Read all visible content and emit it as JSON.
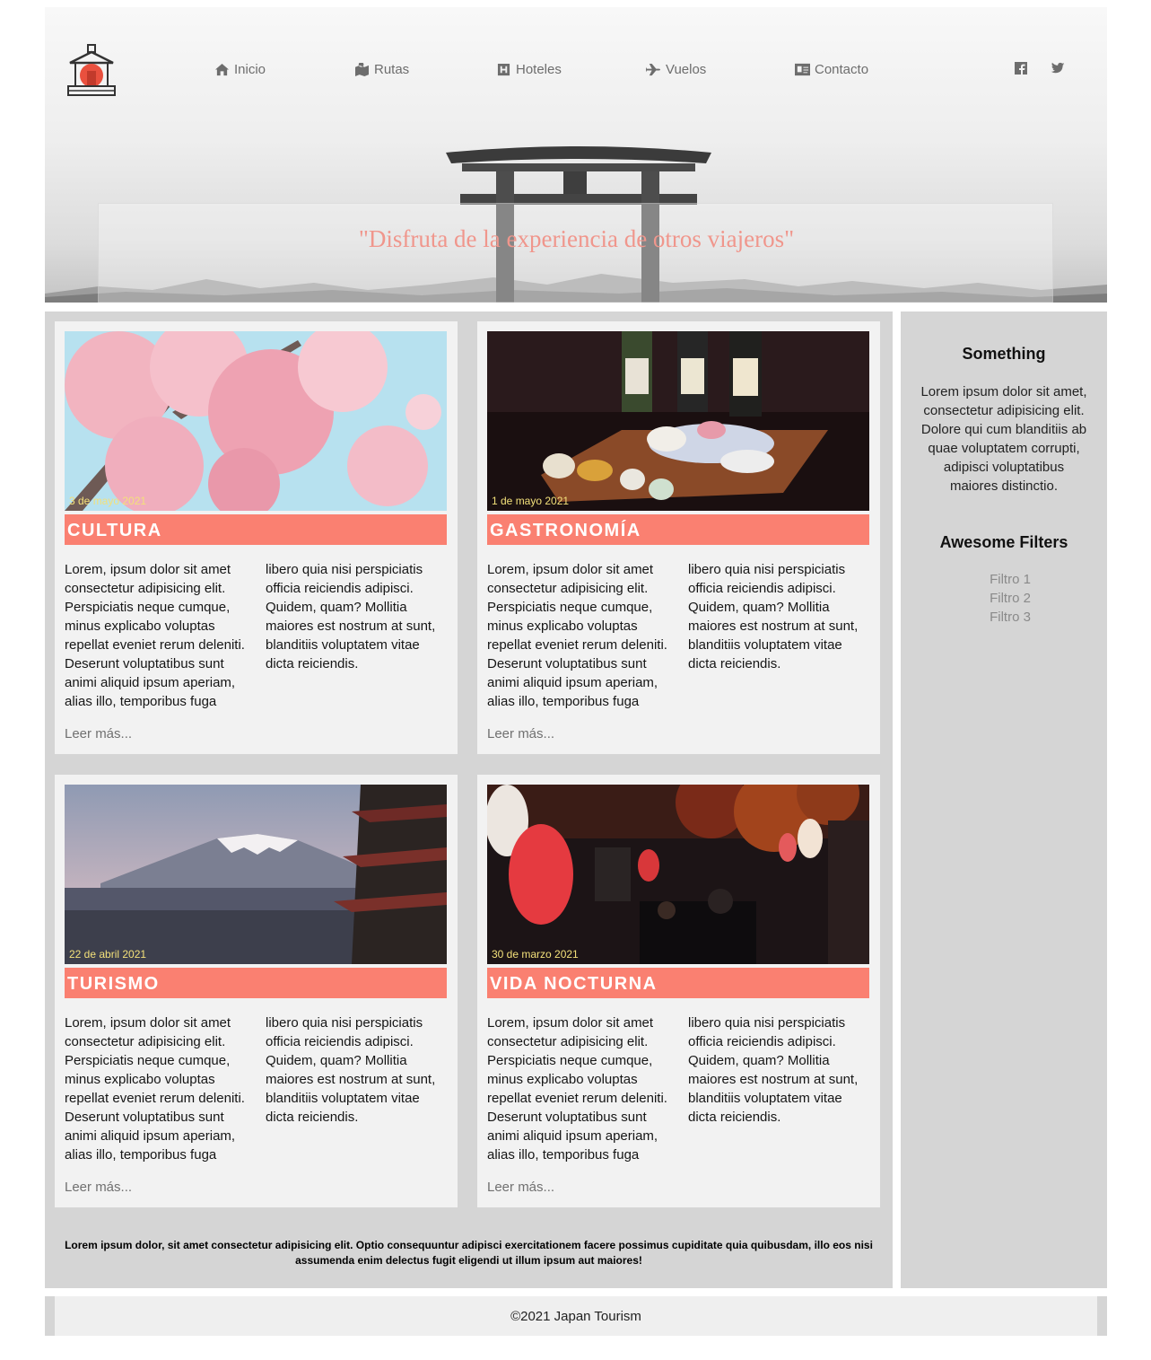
{
  "nav": {
    "items": [
      {
        "label": "Inicio",
        "icon": "home-icon"
      },
      {
        "label": "Rutas",
        "icon": "map-icon"
      },
      {
        "label": "Hoteles",
        "icon": "hotel-icon"
      },
      {
        "label": "Vuelos",
        "icon": "plane-icon"
      },
      {
        "label": "Contacto",
        "icon": "address-card-icon"
      }
    ],
    "social": [
      "facebook-icon",
      "twitter-icon"
    ]
  },
  "hero": {
    "quote": "\"Disfruta de la experiencia de otros viajeros\""
  },
  "cards": [
    {
      "date": "3 de mayo 2021",
      "title": "CULTURA",
      "body": "Lorem, ipsum dolor sit amet consectetur adipisicing elit. Perspiciatis neque cumque, minus explicabo voluptas repellat eveniet rerum deleniti. Deserunt voluptatibus sunt animi aliquid ipsum aperiam, alias illo, temporibus fuga libero quia nisi perspiciatis officia reiciendis adipisci. Quidem, quam? Mollitia maiores est nostrum at sunt, blanditiis voluptatem vitae dicta reiciendis.",
      "more": "Leer más..."
    },
    {
      "date": "1 de mayo 2021",
      "title": "GASTRONOMÍA",
      "body": "Lorem, ipsum dolor sit amet consectetur adipisicing elit. Perspiciatis neque cumque, minus explicabo voluptas repellat eveniet rerum deleniti. Deserunt voluptatibus sunt animi aliquid ipsum aperiam, alias illo, temporibus fuga libero quia nisi perspiciatis officia reiciendis adipisci. Quidem, quam? Mollitia maiores est nostrum at sunt, blanditiis voluptatem vitae dicta reiciendis.",
      "more": "Leer más..."
    },
    {
      "date": "22 de abril 2021",
      "title": "TURISMO",
      "body": "Lorem, ipsum dolor sit amet consectetur adipisicing elit. Perspiciatis neque cumque, minus explicabo voluptas repellat eveniet rerum deleniti. Deserunt voluptatibus sunt animi aliquid ipsum aperiam, alias illo, temporibus fuga libero quia nisi perspiciatis officia reiciendis adipisci. Quidem, quam? Mollitia maiores est nostrum at sunt, blanditiis voluptatem vitae dicta reiciendis.",
      "more": "Leer más..."
    },
    {
      "date": "30 de marzo 2021",
      "title": "VIDA NOCTURNA",
      "body": "Lorem, ipsum dolor sit amet consectetur adipisicing elit. Perspiciatis neque cumque, minus explicabo voluptas repellat eveniet rerum deleniti. Deserunt voluptatibus sunt animi aliquid ipsum aperiam, alias illo, temporibus fuga libero quia nisi perspiciatis officia reiciendis adipisci. Quidem, quam? Mollitia maiores est nostrum at sunt, blanditiis voluptatem vitae dicta reiciendis.",
      "more": "Leer más..."
    }
  ],
  "main_footer": "Lorem ipsum dolor, sit amet consectetur adipisicing elit. Optio consequuntur adipisci exercitationem facere possimus cupiditate quia quibusdam, illo eos nisi assumenda enim delectus fugit eligendi ut illum ipsum aut maiores!",
  "aside": {
    "heading": "Something",
    "text": "Lorem ipsum dolor sit amet, consectetur adipisicing elit. Dolore qui cum blanditiis ab quae voluptatem corrupti, adipisci voluptatibus maiores distinctio.",
    "filters_heading": "Awesome Filters",
    "filters": [
      "Filtro 1",
      "Filtro 2",
      "Filtro 3"
    ]
  },
  "footer": {
    "text": "©2021 Japan Tourism"
  },
  "colors": {
    "accent": "#fa8071",
    "quote": "#f0968c",
    "date": "#f3e07a",
    "panel": "#d5d5d5",
    "card": "#f2f2f2"
  }
}
